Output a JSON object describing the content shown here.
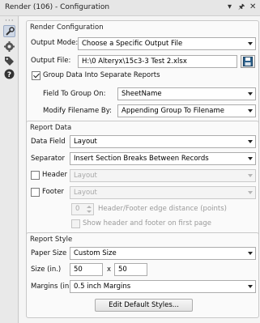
{
  "window": {
    "title": "Render (106) - Configuration",
    "controls": [
      "▾",
      "🖈",
      "✕"
    ]
  },
  "sidebar": {
    "icons": [
      "wrench-icon",
      "gear-icon",
      "tag-icon",
      "help-icon"
    ]
  },
  "render_config": {
    "title": "Render Configuration",
    "output_mode_label": "Output Mode:",
    "output_mode_value": "Choose a Specific Output File",
    "output_file_label": "Output File:",
    "output_file_value": "H:\\0 Alteryx\\15c3-3 Test 2.xlsx",
    "group_data_label": "Group Data Into Separate Reports",
    "group_data_checked": true,
    "field_group_label": "Field To Group On:",
    "field_group_value": "SheetName",
    "modify_filename_label": "Modify Filename By:",
    "modify_filename_value": "Appending Group To Filename"
  },
  "report_data": {
    "title": "Report Data",
    "data_field_label": "Data Field",
    "data_field_value": "Layout",
    "separator_label": "Separator",
    "separator_value": "Insert Section Breaks Between Records",
    "header_label": "Header",
    "header_value": "Layout",
    "footer_label": "Footer",
    "footer_value": "Layout",
    "edge_distance_value": "0",
    "edge_distance_label": "Header/Footer edge distance (points)",
    "show_first_page_label": "Show header and footer on first page"
  },
  "report_style": {
    "title": "Report Style",
    "paper_size_label": "Paper Size",
    "paper_size_value": "Custom Size",
    "size_label": "Size (in.)",
    "size_width": "50",
    "size_x": "x",
    "size_height": "50",
    "margins_label": "Margins (in.)",
    "margins_value": "0.5 inch Margins",
    "edit_styles_label": "Edit Default Styles..."
  }
}
